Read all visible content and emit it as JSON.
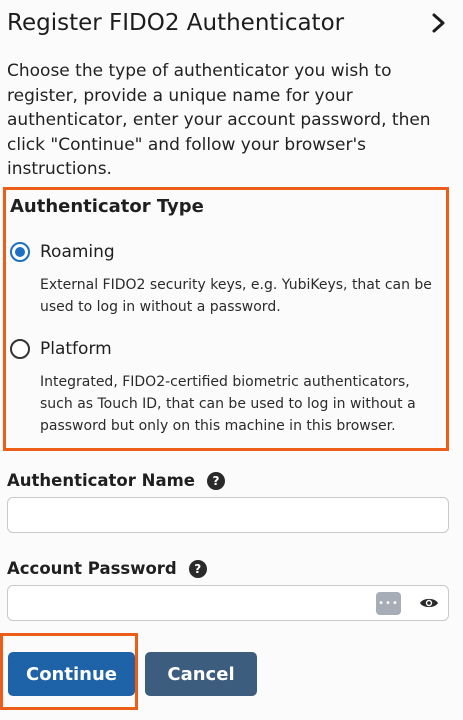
{
  "header": {
    "title": "Register FIDO2 Authenticator",
    "chevron_icon": "chevron-right-icon"
  },
  "intro": "Choose the type of authenticator you wish to register, provide a unique name for your authenticator, enter your account password, then click \"Continue\" and follow your browser's instructions.",
  "authenticator_type": {
    "title": "Authenticator Type",
    "options": [
      {
        "label": "Roaming",
        "checked": true,
        "description": "External FIDO2 security keys, e.g. YubiKeys, that can be used to log in without a password."
      },
      {
        "label": "Platform",
        "checked": false,
        "description": "Integrated, FIDO2-certified biometric authenticators, such as Touch ID, that can be used to log in without a password but only on this machine in this browser."
      }
    ]
  },
  "fields": {
    "name": {
      "label": "Authenticator Name",
      "value": "",
      "help_icon": "?"
    },
    "password": {
      "label": "Account Password",
      "value": "",
      "help_icon": "?",
      "manager_glyph": "•••",
      "reveal_icon": "eye-icon"
    }
  },
  "buttons": {
    "continue": "Continue",
    "cancel": "Cancel"
  },
  "colors": {
    "primary": "#1e63a8",
    "secondary": "#3d5d7f",
    "highlight": "#ec5d17",
    "radio_checked": "#1f6fc5"
  }
}
